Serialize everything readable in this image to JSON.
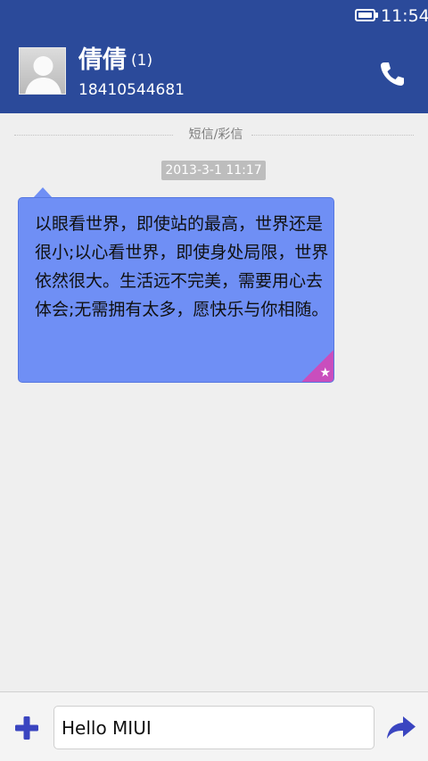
{
  "status_bar": {
    "time": "11:54",
    "battery_icon": "battery-full-icon"
  },
  "header": {
    "contact_name": "倩倩",
    "unread_count": "(1)",
    "phone_number": "18410544681",
    "call_icon": "phone-icon",
    "avatar_icon": "default-avatar-icon"
  },
  "thread": {
    "section_label": "短信/彩信",
    "timestamp": "2013-3-1 11:17",
    "messages": [
      {
        "text": "以眼看世界，即使站的最高，世界还是很小;以心看世界，即使身处局限，世界依然很大。生活远不完美，需要用心去体会;无需拥有太多，愿快乐与你相随。",
        "starred_icon": "star-icon"
      }
    ]
  },
  "compose": {
    "input_value": "Hello MIUI",
    "add_icon": "plus-icon",
    "send_icon": "send-arrow-icon"
  },
  "colors": {
    "header_bg": "#2b4a9a",
    "bubble_bg": "#6f8ff5",
    "star_corner": "#c94ebd",
    "accent_icon": "#3a45c0"
  }
}
